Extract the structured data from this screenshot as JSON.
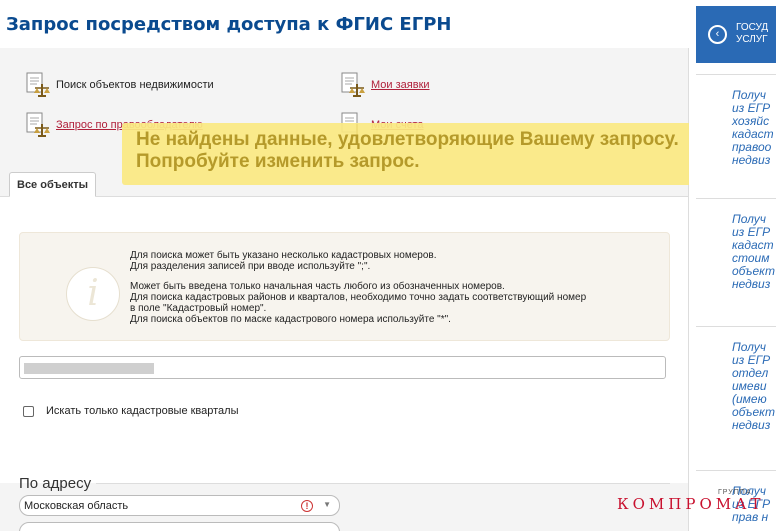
{
  "header": {
    "title": "Запрос посредством доступа к ФГИС ЕГРН"
  },
  "nav": {
    "search_objects": "Поиск объектов недвижимости",
    "my_requests": "Мои заявки",
    "request_by_right_holder": "Запрос по правообладателю",
    "my_accounts": "Мои счета"
  },
  "overlay": {
    "line1": "Не найдены данные, удовлетворяющие Вашему запросу.",
    "line2": "Попробуйте изменить запрос."
  },
  "tabs": {
    "all_objects": "Все объекты"
  },
  "info": {
    "lines": [
      "Для поиска может быть указано несколько кадастровых номеров.",
      "Для разделения записей при вводе используйте \";\".",
      "Может быть введена только начальная часть любого из обозначенных номеров.",
      "Для поиска кадастровых районов и кварталов, необходимо точно задать соответствующий номер",
      "в поле \"Кадастровый номер\".",
      "Для поиска объектов по маске кадастрового номера используйте \"*\"."
    ]
  },
  "search": {
    "value": ""
  },
  "checkbox": {
    "label": "Искать только кадастровые кварталы",
    "checked": false
  },
  "address": {
    "title": "По адресу",
    "region": "Московская область"
  },
  "sidebar": {
    "header": [
      "ГОСУД",
      "УСЛУГ"
    ],
    "items": [
      [
        "Получ",
        "из ЕГР",
        "хозяйс",
        "кадаст",
        "правоо",
        "недвиз"
      ],
      [
        "Получ",
        "из ЕГР",
        "кадаст",
        "стоим",
        "объект",
        "недвиз"
      ],
      [
        "Получ",
        "из ЕГР",
        "отдел",
        "имеви",
        "(имею",
        "объект",
        "недвиз"
      ],
      [
        "Получ",
        "из ЕГР",
        "прав н"
      ]
    ]
  },
  "watermark": {
    "text": "КОМПРОМАТ",
    "small": "ГРУППА"
  },
  "colors": {
    "title": "#0a4a8f",
    "link": "#b0203a",
    "overlay_text": "#b59a2a",
    "sidebar_accent": "#2a6ab5"
  }
}
